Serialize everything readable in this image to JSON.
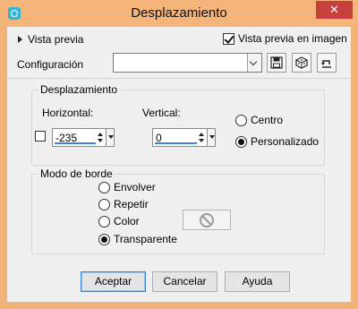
{
  "window": {
    "title": "Desplazamiento",
    "close_label": "✕"
  },
  "top": {
    "preview_toggle_label": "Vista previa",
    "preview_in_image_label": "Vista previa en imagen",
    "preview_in_image_checked": true,
    "config_label": "Configuración",
    "config_value": ""
  },
  "offset_group": {
    "title": "Desplazamiento",
    "horizontal_label": "Horizontal:",
    "horizontal_value": "-235",
    "vertical_label": "Vertical:",
    "vertical_value": "0",
    "radio_center_label": "Centro",
    "radio_custom_label": "Personalizado",
    "selected": "custom"
  },
  "edge_group": {
    "title": "Modo de borde",
    "options": [
      "Envolver",
      "Repetir",
      "Color",
      "Transparente"
    ],
    "selected": "Transparente"
  },
  "buttons": {
    "ok": "Aceptar",
    "cancel": "Cancelar",
    "help": "Ayuda"
  },
  "colors": {
    "titlebar": "#f4b47a",
    "close": "#c7403c",
    "focus": "#3b7fd6"
  }
}
